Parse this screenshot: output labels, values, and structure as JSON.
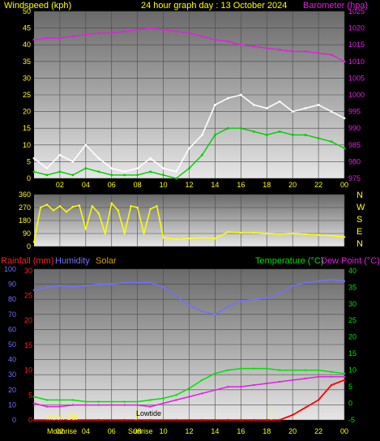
{
  "header": {
    "left_label": "Windspeed (kph)",
    "center_label": "24 hour graph day : 13 October 2024",
    "right_label": "Barometer (hpa)"
  },
  "wind_dir_labels": [
    "N",
    "W",
    "S",
    "E",
    "N"
  ],
  "mid_header": {
    "rainfall": "Rainfall (mm)",
    "humidity": "Humidity",
    "solar": "Solar",
    "temperature": "Temperature (°C)",
    "dew_point": "Dew Point (°C)"
  },
  "annotations": {
    "moon_set_top": "Moon Set",
    "low_tide": "Lowtide",
    "moonrise_label": "Moonrise",
    "sunrise_label": "Sunrise"
  },
  "colors": {
    "windspeed": "#ffffff",
    "gust": "#00cc00",
    "barometer": "#e020e0",
    "wind_direction": "#ffff00",
    "temperature": "#00e000",
    "dew_point": "#e020e0",
    "humidity": "#7070ff",
    "rainfall": "#ff0000",
    "solar": "#d0a000",
    "title": "#ffff00"
  },
  "chart_data": [
    {
      "type": "line",
      "title": "24 hour graph day : 13 October 2024",
      "ylabel": "Windspeed (kph)",
      "y2label": "Barometer (hpa)",
      "x_ticks": [
        "02",
        "04",
        "06",
        "08",
        "10",
        "12",
        "14",
        "16",
        "18",
        "20",
        "22",
        "00"
      ],
      "y_ticks": [
        0,
        5,
        10,
        15,
        20,
        25,
        30,
        35,
        40,
        45,
        50
      ],
      "y2_ticks": [
        975,
        980,
        985,
        990,
        995,
        1000,
        1005,
        1010,
        1015,
        1020,
        1025
      ],
      "ylim": [
        0,
        50
      ],
      "y2lim": [
        975,
        1025
      ],
      "x_hours": [
        0,
        1,
        2,
        3,
        4,
        5,
        6,
        7,
        8,
        9,
        10,
        11,
        12,
        13,
        14,
        15,
        16,
        17,
        18,
        19,
        20,
        21,
        22,
        23,
        24
      ],
      "series": [
        {
          "name": "Windspeed",
          "axis": "left",
          "values": [
            6,
            3,
            7,
            5,
            10,
            6,
            3,
            2,
            3,
            6,
            3,
            2,
            9,
            13,
            22,
            24,
            25,
            22,
            21,
            23,
            20,
            21,
            22,
            20,
            18
          ]
        },
        {
          "name": "Gust",
          "axis": "left",
          "values": [
            2,
            1,
            2,
            1,
            3,
            2,
            1,
            1,
            1,
            2,
            1,
            0,
            3,
            7,
            13,
            15,
            15,
            14,
            13,
            14,
            13,
            13,
            12,
            11,
            9
          ]
        },
        {
          "name": "Barometer",
          "axis": "right",
          "values": [
            1016.5,
            1017,
            1017,
            1017.5,
            1018,
            1018.5,
            1018.5,
            1019,
            1019.5,
            1020,
            1019.5,
            1019,
            1018.5,
            1017.5,
            1016.5,
            1016,
            1015,
            1014.5,
            1014,
            1013.5,
            1013,
            1013,
            1012.5,
            1012,
            1010
          ]
        }
      ]
    },
    {
      "type": "line",
      "ylabel": "Wind direction",
      "y_ticks": [
        0,
        90,
        180,
        270,
        360
      ],
      "ylim": [
        0,
        360
      ],
      "x_hours": [
        0,
        0.5,
        1,
        1.5,
        2,
        2.5,
        3,
        3.5,
        4,
        4.5,
        5,
        5.5,
        6,
        6.5,
        7,
        7.5,
        8,
        8.5,
        9,
        9.5,
        10,
        11,
        12,
        13,
        14,
        15,
        16,
        17,
        18,
        19,
        20,
        21,
        22,
        23,
        24
      ],
      "series": [
        {
          "name": "Wind Direction",
          "values": [
            30,
            270,
            290,
            250,
            280,
            240,
            275,
            285,
            120,
            280,
            230,
            90,
            300,
            250,
            90,
            280,
            270,
            90,
            260,
            280,
            60,
            50,
            55,
            60,
            55,
            100,
            95,
            95,
            90,
            85,
            90,
            85,
            80,
            75,
            65
          ]
        }
      ]
    },
    {
      "type": "line",
      "ylabel_left": "Rainfall (mm) / Humidity",
      "ylabel_right": "Temperature (°C) / Dew Point (°C)",
      "x_ticks": [
        "02",
        "04",
        "06",
        "08",
        "10",
        "12",
        "14",
        "16",
        "18",
        "20",
        "22",
        "00"
      ],
      "y_ticks_humidity": [
        0,
        10,
        20,
        30,
        40,
        50,
        60,
        70,
        80,
        90,
        100
      ],
      "y_ticks_rain": [
        0,
        5,
        10,
        15,
        20,
        25,
        30
      ],
      "y_ticks_temp": [
        -5,
        0,
        5,
        10,
        15,
        20,
        25,
        30,
        35,
        40
      ],
      "x_hours": [
        0,
        1,
        2,
        3,
        4,
        5,
        6,
        7,
        8,
        9,
        10,
        11,
        12,
        13,
        14,
        15,
        16,
        17,
        18,
        19,
        20,
        21,
        22,
        23,
        24
      ],
      "series": [
        {
          "name": "Humidity",
          "axis": "humidity",
          "values": [
            86,
            88,
            89,
            88,
            89,
            90,
            90,
            91,
            91,
            91,
            88,
            82,
            76,
            72,
            70,
            75,
            79,
            80,
            81,
            84,
            89,
            91,
            92,
            93,
            92
          ]
        },
        {
          "name": "Temperature",
          "axis": "temp",
          "values": [
            2,
            1,
            1,
            1,
            0.5,
            0.5,
            0.5,
            0.5,
            0.5,
            1,
            1.5,
            2.5,
            4.5,
            7,
            9,
            10,
            10.5,
            10.5,
            10.5,
            10,
            10,
            10,
            10,
            9.5,
            9
          ]
        },
        {
          "name": "Dew Point",
          "axis": "temp",
          "values": [
            0,
            -1,
            -1,
            -0.5,
            -0.5,
            -0.5,
            -0.5,
            -0.5,
            -0.5,
            -1,
            0,
            1,
            2,
            3,
            4,
            5,
            5,
            5.5,
            6,
            6.5,
            7,
            7.5,
            8,
            8,
            8
          ]
        },
        {
          "name": "Rainfall",
          "axis": "rain",
          "values": [
            0,
            0,
            0,
            0,
            0,
            0,
            0,
            0,
            0,
            0,
            0,
            0,
            0,
            0,
            0,
            0,
            0,
            0,
            0,
            0,
            1,
            2.5,
            4,
            7,
            8
          ]
        }
      ]
    }
  ]
}
